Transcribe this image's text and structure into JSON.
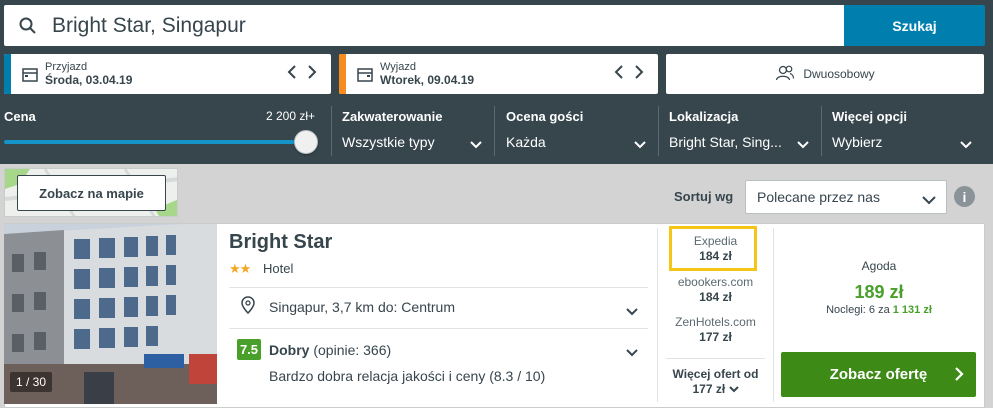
{
  "search": {
    "query": "Bright Star, Singapur",
    "button_label": "Szukaj"
  },
  "checkin": {
    "label": "Przyjazd",
    "value": "Środa, 03.04.19",
    "accent": "#007faf"
  },
  "checkout": {
    "label": "Wyjazd",
    "value": "Wtorek, 09.04.19",
    "accent": "#f68c1f"
  },
  "guests": {
    "value": "Dwuosobowy"
  },
  "filters": {
    "price": {
      "label": "Cena",
      "value": "2 200 zł+",
      "level": 1.0
    },
    "accommodation": {
      "label": "Zakwaterowanie",
      "value": "Wszystkie typy"
    },
    "rating": {
      "label": "Ocena gości",
      "value": "Każda"
    },
    "location": {
      "label": "Lokalizacja",
      "value": "Bright Star, Sing..."
    },
    "more": {
      "label": "Więcej opcji",
      "value": "Wybierz"
    }
  },
  "map": {
    "button_label": "Zobacz na mapie"
  },
  "sort": {
    "label": "Sortuj wg",
    "value": "Polecane przez nas",
    "info": "i"
  },
  "hotel": {
    "photo_counter": "1 / 30",
    "name": "Bright Star",
    "stars": 2,
    "stars_text": "★★",
    "type": "Hotel",
    "location": "Singapur, 3,7 km do: Centrum",
    "rating_score": "7.5",
    "rating_word": "Dobry",
    "rating_reviews": "(opinie: 366)",
    "rating_detail": "Bardzo dobra relacja jakości i ceny (8.3 / 10)"
  },
  "offers": [
    {
      "site": "Expedia",
      "price": "184 zł",
      "highlighted": true
    },
    {
      "site": "ebookers.com",
      "price": "184 zł"
    },
    {
      "site": "ZenHotels.com",
      "price": "177 zł"
    }
  ],
  "more_offers": {
    "label": "Więcej ofert od",
    "price": "177 zł"
  },
  "best_deal": {
    "site": "Agoda",
    "price": "189 zł",
    "nights_prefix": "Noclegi: 6 za ",
    "nights_total": "1 131 zł",
    "button_label": "Zobacz ofertę"
  },
  "colors": {
    "header_bg": "#37454d",
    "search_button": "#007faf",
    "deal_button": "#3d8a16",
    "rating_badge": "#489f2a",
    "highlight": "#f5c518"
  }
}
